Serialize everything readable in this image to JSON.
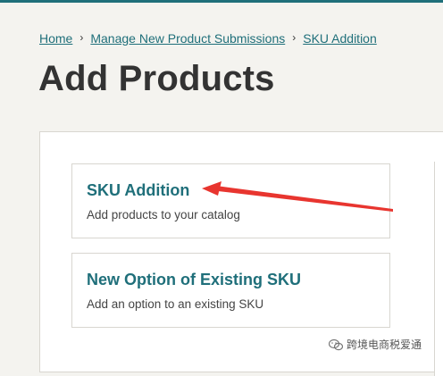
{
  "breadcrumb": {
    "items": [
      "Home",
      "Manage New Product Submissions",
      "SKU Addition"
    ],
    "separator": "›"
  },
  "page": {
    "title": "Add Products"
  },
  "options": [
    {
      "title": "SKU Addition",
      "description": "Add products to your catalog"
    },
    {
      "title": "New Option of Existing SKU",
      "description": "Add an option to an existing SKU"
    }
  ],
  "annotation": {
    "arrow_color": "#e8352f",
    "points_to": "SKU Addition"
  },
  "watermark": {
    "text": "跨境电商税爱通"
  },
  "colors": {
    "accent": "#1f6f7a",
    "background": "#f4f3ef",
    "text": "#333333"
  }
}
